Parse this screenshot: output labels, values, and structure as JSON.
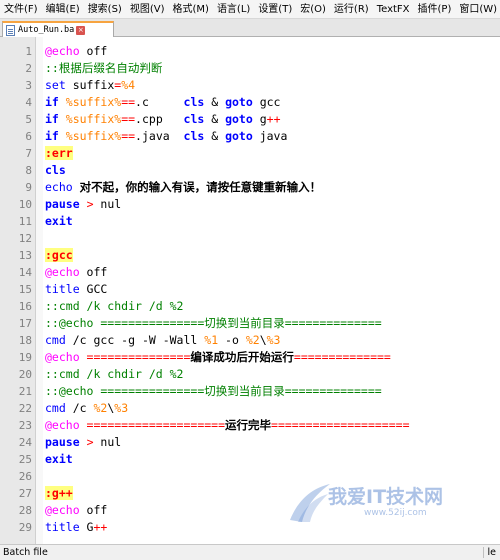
{
  "menu": [
    "文件(F)",
    "编辑(E)",
    "搜索(S)",
    "视图(V)",
    "格式(M)",
    "语言(L)",
    "设置(T)",
    "宏(O)",
    "运行(R)",
    "TextFX",
    "插件(P)",
    "窗口(W)"
  ],
  "tab": {
    "name": "Auto_Run.ba",
    "close": "×"
  },
  "lines": [
    [
      [
        "t-echo",
        "@echo"
      ],
      [
        "",
        "&nbsp;off"
      ]
    ],
    [
      [
        "t-cmt",
        "::根据后缀名自动判断"
      ]
    ],
    [
      [
        "t-kw2",
        "set"
      ],
      [
        "",
        "&nbsp;suffix"
      ],
      [
        "t-op",
        "="
      ],
      [
        "t-var",
        "%4"
      ]
    ],
    [
      [
        "t-kw",
        "if"
      ],
      [
        "",
        "&nbsp;"
      ],
      [
        "t-var",
        "%suffix%"
      ],
      [
        "t-op",
        "=="
      ],
      [
        "",
        ".c&nbsp;&nbsp;&nbsp;&nbsp;&nbsp;"
      ],
      [
        "t-kw",
        "cls"
      ],
      [
        "",
        "&nbsp;&amp;&nbsp;"
      ],
      [
        "t-kw",
        "goto"
      ],
      [
        "",
        "&nbsp;gcc"
      ]
    ],
    [
      [
        "t-kw",
        "if"
      ],
      [
        "",
        "&nbsp;"
      ],
      [
        "t-var",
        "%suffix%"
      ],
      [
        "t-op",
        "=="
      ],
      [
        "",
        ".cpp&nbsp;&nbsp;&nbsp;"
      ],
      [
        "t-kw",
        "cls"
      ],
      [
        "",
        "&nbsp;&amp;&nbsp;"
      ],
      [
        "t-kw",
        "goto"
      ],
      [
        "",
        "&nbsp;g"
      ],
      [
        "t-op",
        "++"
      ]
    ],
    [
      [
        "t-kw",
        "if"
      ],
      [
        "",
        "&nbsp;"
      ],
      [
        "t-var",
        "%suffix%"
      ],
      [
        "t-op",
        "=="
      ],
      [
        "",
        ".java&nbsp;&nbsp;"
      ],
      [
        "t-kw",
        "cls"
      ],
      [
        "",
        "&nbsp;&amp;&nbsp;"
      ],
      [
        "t-kw",
        "goto"
      ],
      [
        "",
        "&nbsp;java"
      ]
    ],
    [
      [
        "t-lbl",
        ":err"
      ]
    ],
    [
      [
        "t-kw",
        "cls"
      ]
    ],
    [
      [
        "t-kw2",
        "echo"
      ],
      [
        "",
        "&nbsp;"
      ],
      [
        "t-cn",
        "对不起，你的输入有误，请按任意键重新输入！"
      ]
    ],
    [
      [
        "t-kw",
        "pause"
      ],
      [
        "",
        "&nbsp;"
      ],
      [
        "t-op",
        "&gt;"
      ],
      [
        "",
        "&nbsp;nul"
      ]
    ],
    [
      [
        "t-kw",
        "exit"
      ]
    ],
    [
      [
        "",
        ""
      ]
    ],
    [
      [
        "t-lbl",
        ":gcc"
      ]
    ],
    [
      [
        "t-echo",
        "@echo"
      ],
      [
        "",
        "&nbsp;off"
      ]
    ],
    [
      [
        "t-kw2",
        "title"
      ],
      [
        "",
        "&nbsp;GCC"
      ]
    ],
    [
      [
        "t-cmt",
        "::cmd&nbsp;/k&nbsp;chdir&nbsp;/d&nbsp;%2"
      ]
    ],
    [
      [
        "t-cmt",
        "::@echo&nbsp;===============切换到当前目录=============="
      ]
    ],
    [
      [
        "t-kw2",
        "cmd"
      ],
      [
        "",
        "&nbsp;/c&nbsp;gcc&nbsp;-g&nbsp;-W&nbsp;-Wall&nbsp;"
      ],
      [
        "t-var",
        "%1"
      ],
      [
        "",
        "&nbsp;-o&nbsp;"
      ],
      [
        "t-var",
        "%2"
      ],
      [
        "",
        "\\"
      ],
      [
        "t-var",
        "%3"
      ]
    ],
    [
      [
        "t-echo",
        "@echo"
      ],
      [
        "t-op",
        "&nbsp;==============="
      ],
      [
        "t-cn",
        "编译成功后开始运行"
      ],
      [
        "t-op",
        "=============="
      ]
    ],
    [
      [
        "t-cmt",
        "::cmd&nbsp;/k&nbsp;chdir&nbsp;/d&nbsp;%2"
      ]
    ],
    [
      [
        "t-cmt",
        "::@echo&nbsp;===============切换到当前目录=============="
      ]
    ],
    [
      [
        "t-kw2",
        "cmd"
      ],
      [
        "",
        "&nbsp;/c&nbsp;"
      ],
      [
        "t-var",
        "%2"
      ],
      [
        "",
        "\\"
      ],
      [
        "t-var",
        "%3"
      ]
    ],
    [
      [
        "t-echo",
        "@echo"
      ],
      [
        "t-op",
        "&nbsp;===================="
      ],
      [
        "t-cn",
        "运行完毕"
      ],
      [
        "t-op",
        "===================="
      ]
    ],
    [
      [
        "t-kw",
        "pause"
      ],
      [
        "",
        "&nbsp;"
      ],
      [
        "t-op",
        "&gt;"
      ],
      [
        "",
        "&nbsp;nul"
      ]
    ],
    [
      [
        "t-kw",
        "exit"
      ]
    ],
    [
      [
        "",
        ""
      ]
    ],
    [
      [
        "t-lbl",
        ":g++"
      ]
    ],
    [
      [
        "t-echo",
        "@echo"
      ],
      [
        "",
        "&nbsp;off"
      ]
    ],
    [
      [
        "t-kw2",
        "title"
      ],
      [
        "",
        "&nbsp;G"
      ],
      [
        "t-op",
        "++"
      ]
    ]
  ],
  "watermark": {
    "text": "我爱IT技术网",
    "url": "www.52ij.com"
  },
  "status": {
    "left": "Batch file",
    "right": "le"
  }
}
